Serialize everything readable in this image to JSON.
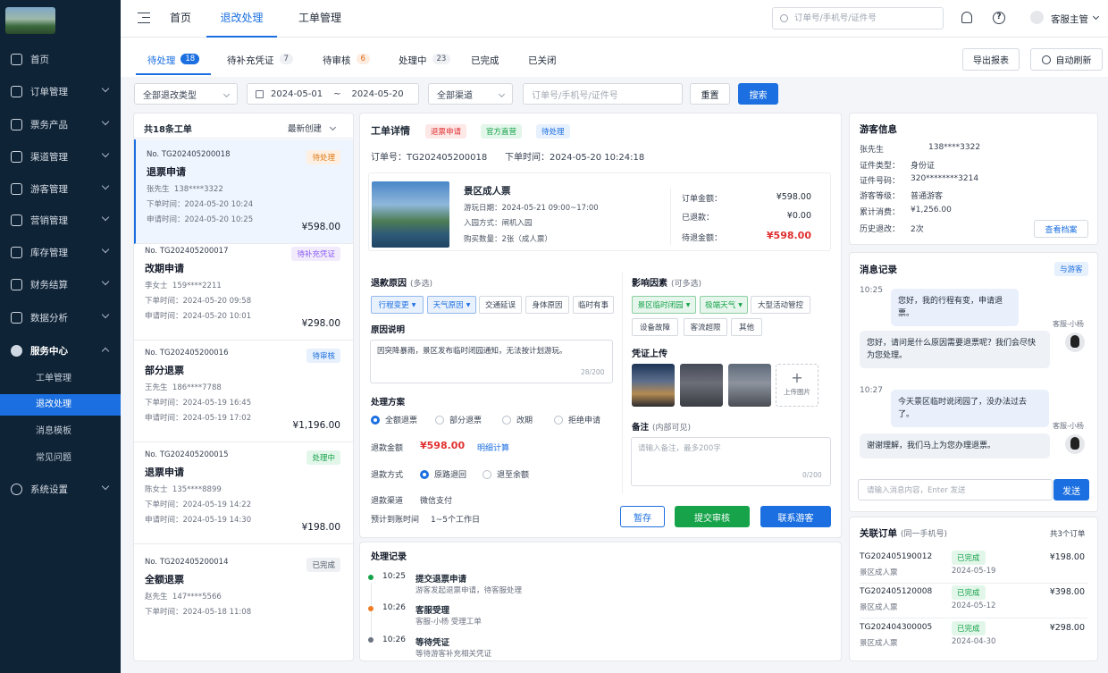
{
  "sidebar": {
    "items": [
      {
        "label": "首页"
      },
      {
        "label": "订单管理"
      },
      {
        "label": "票务产品"
      },
      {
        "label": "渠道管理"
      },
      {
        "label": "游客管理"
      },
      {
        "label": "营销管理"
      },
      {
        "label": "库存管理"
      },
      {
        "label": "财务结算"
      },
      {
        "label": "数据分析"
      },
      {
        "label": "服务中心"
      },
      {
        "label": "工单管理"
      },
      {
        "label": "退改处理"
      },
      {
        "label": "消息模板"
      },
      {
        "label": "常见问题"
      },
      {
        "label": "系统设置"
      }
    ]
  },
  "topbar": {
    "home": "首页",
    "refund": "退改处理",
    "workorder": "工单管理",
    "search_placeholder": "订单号/手机号/证件号",
    "user": "客服主管"
  },
  "tabs": [
    {
      "label": "待处理",
      "count": "18"
    },
    {
      "label": "待补充凭证",
      "count": "7"
    },
    {
      "label": "待审核",
      "count": "6"
    },
    {
      "label": "处理中",
      "count": "23"
    },
    {
      "label": "已完成"
    },
    {
      "label": "已关闭"
    }
  ],
  "toolbar": {
    "export": "导出报表",
    "auto_refresh": "自动刷新"
  },
  "filters": {
    "type": "全部退改类型",
    "date_start": "2024-05-01",
    "date_sep": "~",
    "date_end": "2024-05-20",
    "channel": "全部渠道",
    "keyword_placeholder": "订单号/手机号/证件号",
    "reset": "重置",
    "search": "搜索"
  },
  "list": {
    "count_label": "共18条工单",
    "sort": "最新创建",
    "items": [
      {
        "no": "No. TG202405200018",
        "status": "待处理",
        "title": "退票申请",
        "name": "张先生",
        "phone": "138****3322",
        "order_time": "下单时间：2024-05-20 10:24",
        "apply_time": "申请时间：2024-05-20 10:25",
        "amount": "¥598.00"
      },
      {
        "no": "No. TG202405200017",
        "status": "待补充凭证",
        "title": "改期申请",
        "name": "李女士",
        "phone": "159****2211",
        "order_time": "下单时间：2024-05-20 09:58",
        "apply_time": "申请时间：2024-05-20 10:01",
        "amount": "¥298.00"
      },
      {
        "no": "No. TG202405200016",
        "status": "待审核",
        "title": "部分退票",
        "name": "王先生",
        "phone": "186****7788",
        "order_time": "下单时间：2024-05-19 16:45",
        "apply_time": "申请时间：2024-05-19 17:02",
        "amount": "¥1,196.00"
      },
      {
        "no": "No. TG202405200015",
        "status": "处理中",
        "title": "退票申请",
        "name": "陈女士",
        "phone": "135****8899",
        "order_time": "下单时间：2024-05-19 14:22",
        "apply_time": "申请时间：2024-05-19 14:30",
        "amount": "¥198.00"
      },
      {
        "no": "No. TG202405200014",
        "status": "已完成",
        "title": "全额退票",
        "name": "赵先生",
        "phone": "147****5566",
        "order_time": "下单时间：2024-05-18 11:08"
      }
    ]
  },
  "detail": {
    "title": "工单详情",
    "tags": [
      "退票申请",
      "官方直营",
      "待处理"
    ],
    "order_no": "订单号：TG202405200018",
    "order_time": "下单时间：2024-05-20 10:24:18",
    "product": {
      "name": "景区成人票",
      "visit_date": "游玩日期：2024-05-21 09:00~17:00",
      "entry": "入园方式：闸机入园",
      "qty": "购买数量：2张（成人票）",
      "order_amount_label": "订单金额：",
      "order_amount": "¥598.00",
      "refunded_label": "已退款：",
      "refunded": "¥0.00",
      "pending_label": "待退金额：",
      "pending": "¥598.00"
    },
    "reason": {
      "title": "退款原因",
      "hint": "(多选)",
      "chips": [
        "行程变更",
        "天气原因",
        "交通延误",
        "身体原因",
        "临时有事"
      ]
    },
    "impact": {
      "title": "影响因素",
      "hint": "(可多选)",
      "chips": [
        "景区临时闭园",
        "极端天气",
        "大型活动管控",
        "设备故障",
        "客流超限",
        "其他"
      ]
    },
    "desc": {
      "title": "原因说明",
      "text": "因突降暴雨，景区发布临时闭园通知，无法按计划游玩。",
      "count": "28/200"
    },
    "upload": {
      "title": "凭证上传",
      "add": "上传图片"
    },
    "plan": {
      "title": "处理方案",
      "options": [
        "全额退票",
        "部分退票",
        "改期",
        "拒绝申请"
      ],
      "amount_label": "退款金额",
      "amount": "¥598.00",
      "calc": "明细计算",
      "method_label": "退款方式",
      "methods": [
        "原路退回",
        "退至余额"
      ],
      "channel_label": "退款渠道",
      "channel": "微信支付",
      "eta_label": "预计到账时间",
      "eta": "1~5个工作日"
    },
    "remark": {
      "title": "备注",
      "hint": "(内部可见)",
      "placeholder": "请输入备注，最多200字",
      "count": "0/200"
    },
    "actions": {
      "save": "暂存",
      "submit": "提交审核",
      "contact": "联系游客"
    }
  },
  "records": {
    "title": "处理记录",
    "items": [
      {
        "time": "10:25",
        "title": "提交退票申请",
        "desc": "游客发起退票申请，待客服处理"
      },
      {
        "time": "10:26",
        "title": "客服受理",
        "desc": "客服-小杨 受理工单"
      },
      {
        "time": "10:26",
        "title": "等待凭证",
        "desc": "等待游客补充相关凭证"
      }
    ]
  },
  "visitor": {
    "title": "游客信息",
    "name": "张先生",
    "phone": "138****3322",
    "id_type_label": "证件类型：",
    "id_type": "身份证",
    "id_no_label": "证件号码：",
    "id_no": "320********3214",
    "level_label": "游客等级：",
    "level": "普通游客",
    "spend_label": "累计消费：",
    "spend": "¥1,256.00",
    "history_label": "历史退改：",
    "history": "2次",
    "archive": "查看档案"
  },
  "messages": {
    "title": "消息记录",
    "with": "与游客",
    "items": [
      {
        "time": "10:25",
        "text": "您好，我的行程有变，申请退票。"
      },
      {
        "sender": "客服-小杨",
        "text": "您好，请问是什么原因需要退票呢？我们会尽快为您处理。"
      },
      {
        "time": "10:27",
        "text": "今天景区临时说闭园了，没办法过去了。"
      },
      {
        "sender": "客服-小杨",
        "text": "谢谢理解，我们马上为您办理退票。"
      }
    ],
    "input_placeholder": "请输入消息内容，Enter 发送",
    "send": "发送"
  },
  "related": {
    "title": "关联订单",
    "hint": "(同一手机号)",
    "total": "共3个订单",
    "items": [
      {
        "no": "TG202405190012",
        "product": "景区成人票",
        "status": "已完成",
        "date": "2024-05-19",
        "amount": "¥198.00"
      },
      {
        "no": "TG202405120008",
        "product": "景区成人票",
        "status": "已完成",
        "date": "2024-05-12",
        "amount": "¥398.00"
      },
      {
        "no": "TG202404300005",
        "product": "景区成人票",
        "status": "已完成",
        "date": "2024-04-30",
        "amount": "¥298.00"
      }
    ]
  }
}
